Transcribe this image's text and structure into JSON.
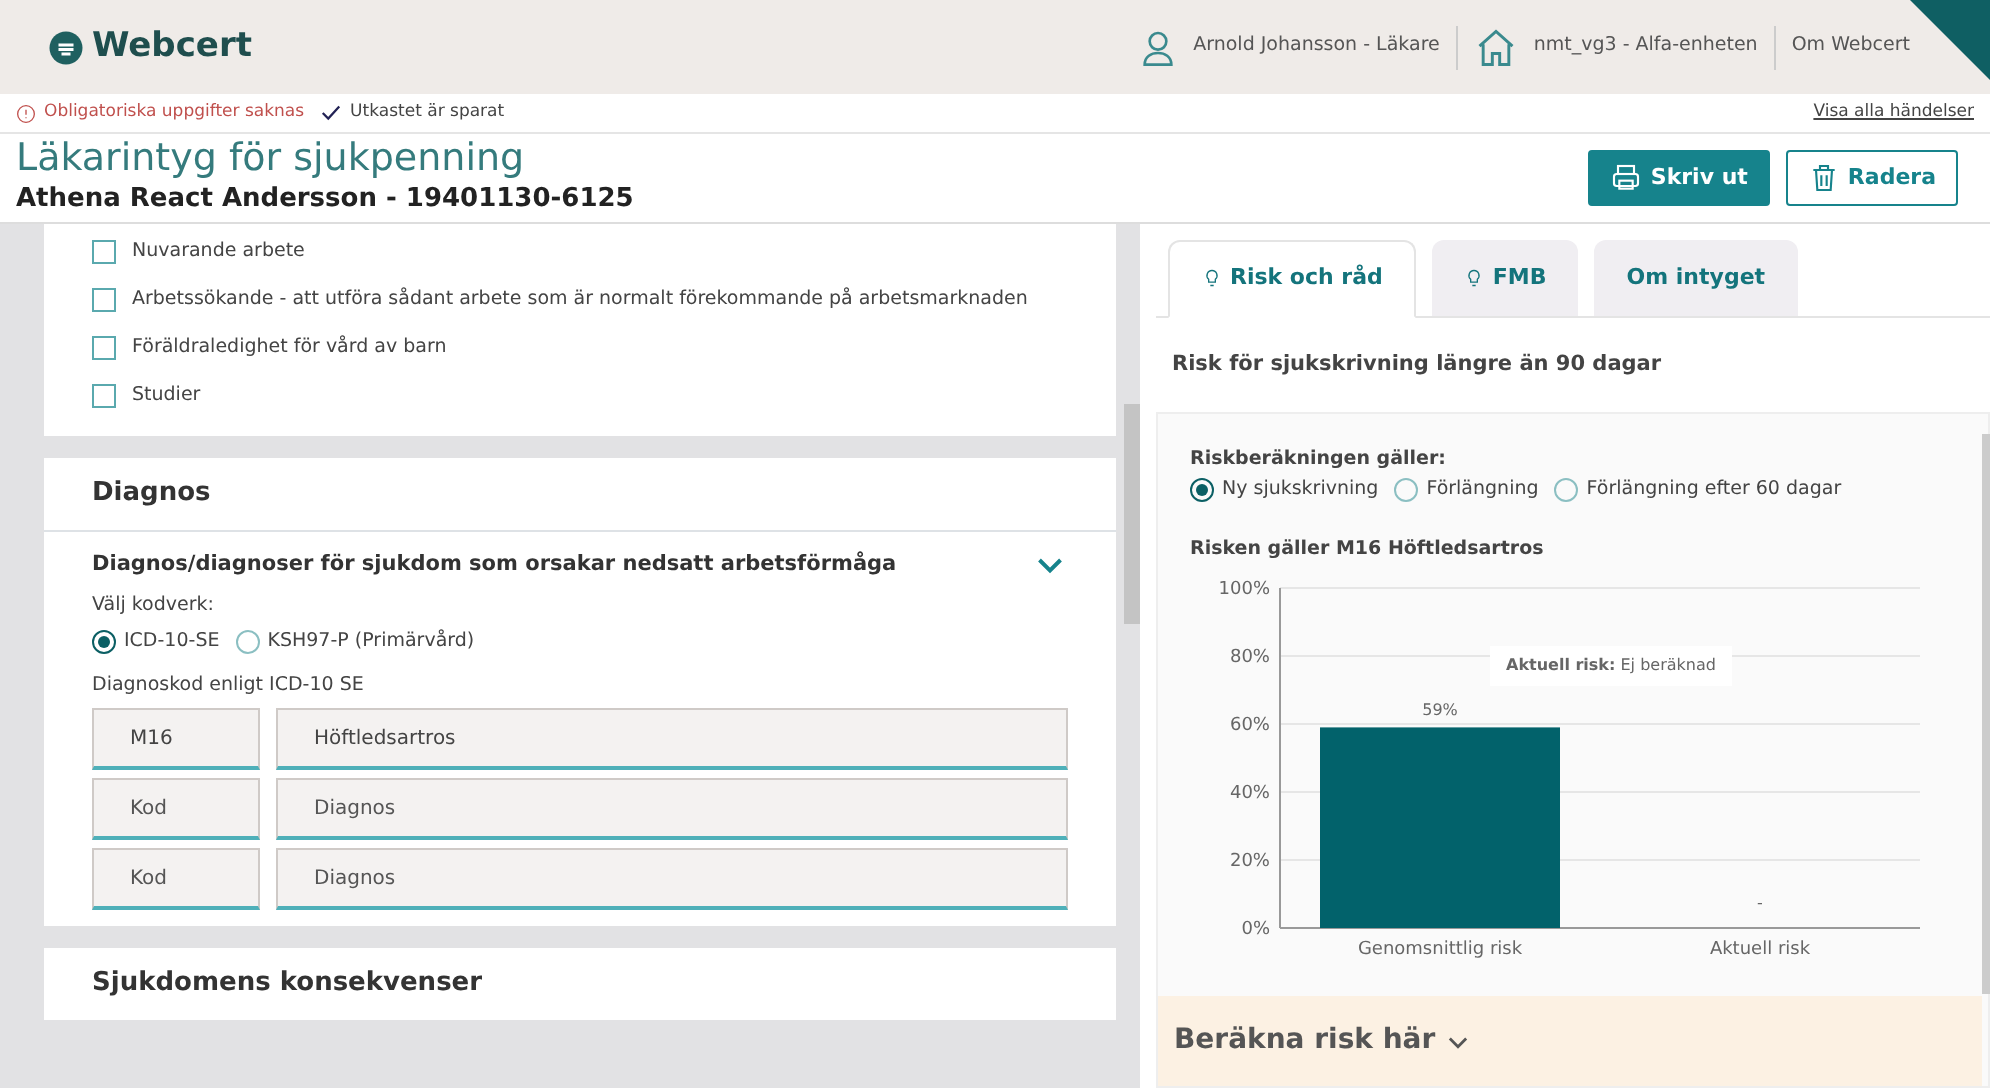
{
  "header": {
    "logo": "Webcert",
    "user": "Arnold Johansson - Läkare",
    "unit": "nmt_vg3 - Alfa-enheten",
    "about": "Om Webcert"
  },
  "status": {
    "warning": "Obligatoriska uppgifter saknas",
    "saved": "Utkastet är sparat",
    "events_link": "Visa alla händelser"
  },
  "title": "Läkarintyg för sjukpenning",
  "patient": "Athena React Andersson - 19401130-6125",
  "buttons": [
    {
      "label": "Skriv ut",
      "kind": "print"
    },
    {
      "label": "Radera",
      "kind": "delete"
    }
  ],
  "occupation": [
    {
      "label": "Nuvarande arbete",
      "checked": false
    },
    {
      "label": "Arbetssökande - att utföra sådant arbete som är normalt förekommande på arbetsmarknaden",
      "checked": false
    },
    {
      "label": "Föräldraledighet för vård av barn",
      "checked": false
    },
    {
      "label": "Studier",
      "checked": false
    }
  ],
  "diagnosis": {
    "heading": "Diagnos",
    "question": "Diagnos/diagnoser för sjukdom som orsakar nedsatt arbetsförmåga",
    "expanded": true,
    "codesystem_label": "Välj kodverk:",
    "codesystems": [
      {
        "label": "ICD-10-SE",
        "selected": true
      },
      {
        "label": "KSH97-P (Primärvård)",
        "selected": false
      }
    ],
    "code_label": "Diagnoskod enligt ICD-10 SE",
    "rows": [
      {
        "code": {
          "value": "M16"
        },
        "name": {
          "value": "Höftledsartros"
        }
      },
      {
        "code": {
          "placeholder": "Kod"
        },
        "name": {
          "placeholder": "Diagnos"
        }
      },
      {
        "code": {
          "placeholder": "Kod"
        },
        "name": {
          "placeholder": "Diagnos"
        }
      }
    ]
  },
  "next_section": "Sjukdomens konsekvenser",
  "side": {
    "tabs": [
      {
        "label": "Risk och råd",
        "kind": "hint",
        "selected": true
      },
      {
        "label": "FMB",
        "kind": "hint",
        "selected": false
      },
      {
        "label": "Om intyget",
        "kind": "plain",
        "selected": false
      }
    ],
    "risk_title": "Risk för sjukskrivning längre än 90 dagar",
    "applies_label": "Riskberäkningen gäller:",
    "applies_options": [
      {
        "label": "Ny sjukskrivning",
        "selected": true
      },
      {
        "label": "Förlängning",
        "selected": false
      },
      {
        "label": "Förlängning efter 60 dagar",
        "selected": false
      }
    ],
    "chart_heading": "Risken gäller M16 Höftledsartros",
    "chart_data": {
      "type": "bar",
      "categories": [
        "Genomsnittlig risk",
        "Aktuell risk"
      ],
      "series": [
        {
          "color": "#02626b",
          "values": [
            59,
            null
          ]
        }
      ],
      "grid": true,
      "ylim": [
        0,
        100
      ],
      "yticks": [
        {
          "value": 0,
          "label": "0%"
        },
        {
          "value": 20,
          "label": "20%"
        },
        {
          "value": 40,
          "label": "40%"
        },
        {
          "value": 60,
          "label": "60%"
        },
        {
          "value": 80,
          "label": "80%"
        },
        {
          "value": 100,
          "label": "100%"
        }
      ],
      "value_labels": [
        "59%",
        "-"
      ],
      "annotations": [
        {
          "text": "**Aktuell risk:** Ej beräknad"
        }
      ]
    },
    "calc_label": "Beräkna risk här"
  }
}
